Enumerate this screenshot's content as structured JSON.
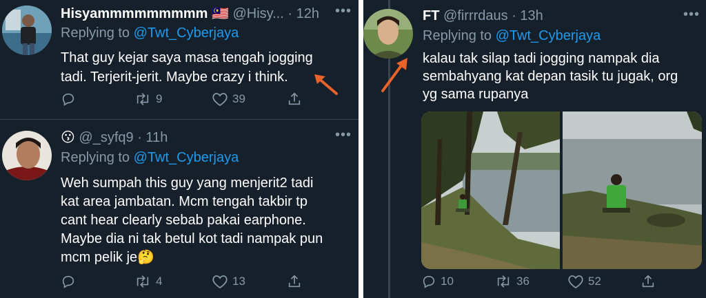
{
  "left_tweets": [
    {
      "display_name": "Hisyammmmmmmmm",
      "flag": "🇲🇾",
      "handle": "@Hisy...",
      "time": "· 12h",
      "replying_prefix": "Replying to",
      "replying_to": "@Twt_Cyberjaya",
      "text_lines": [
        "That guy kejar saya masa tengah jogging",
        "tadi. Terjerit-jerit. Maybe crazy i think."
      ],
      "retweets": "9",
      "likes": "39"
    },
    {
      "emoji": "😗",
      "handle": "@_syfq9",
      "time": "· 11h",
      "replying_prefix": "Replying to",
      "replying_to": "@Twt_Cyberjaya",
      "text_lines": [
        "Weh sumpah this guy yang menjerit2 tadi",
        "kat area jambatan. Mcm tengah takbir tp",
        "cant hear clearly sebab pakai earphone.",
        "Maybe dia ni tak betul kot tadi nampak pun",
        "mcm pelik je🤔"
      ],
      "retweets": "4",
      "likes": "13"
    }
  ],
  "right_tweet": {
    "display_name": "FT",
    "handle": "@firrrdaus",
    "time": "· 13h",
    "replying_prefix": "Replying to",
    "replying_to": "@Twt_Cyberjaya",
    "text_lines": [
      "kalau tak silap tadi jogging nampak dia",
      "sembahyang kat depan tasik tu jugak, org",
      "yg sama rupanya"
    ],
    "replies": "10",
    "retweets": "36",
    "likes": "52"
  },
  "colors": {
    "background": "#15202b",
    "muted": "#8899a6",
    "mention": "#1d9bf0",
    "annotation_arrow": "#e8622a"
  },
  "icons": [
    "reply-icon",
    "retweet-icon",
    "like-icon",
    "share-icon",
    "more-icon",
    "annotation-arrow"
  ]
}
